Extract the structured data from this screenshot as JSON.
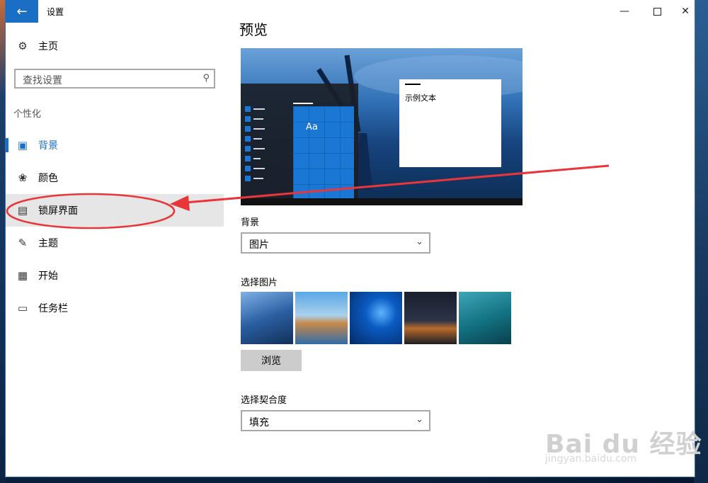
{
  "window": {
    "title": "设置",
    "back_icon": "arrow-left-icon",
    "accent": "#1a6fc4"
  },
  "sidebar": {
    "home_label": "主页",
    "search_placeholder": "查找设置",
    "section": "个性化",
    "items": [
      {
        "label": "背景",
        "icon": "picture-icon",
        "active": true
      },
      {
        "label": "颜色",
        "icon": "palette-icon",
        "active": false
      },
      {
        "label": "锁屏界面",
        "icon": "lock-screen-icon",
        "active": false,
        "highlighted": true
      },
      {
        "label": "主题",
        "icon": "theme-brush-icon",
        "active": false
      },
      {
        "label": "开始",
        "icon": "start-grid-icon",
        "active": false
      },
      {
        "label": "任务栏",
        "icon": "taskbar-icon",
        "active": false
      }
    ]
  },
  "main": {
    "heading": "预览",
    "preview_sample_text": "示例文本",
    "preview_tile_text": "Aa",
    "background_label": "背景",
    "background_value": "图片",
    "choose_picture_label": "选择图片",
    "browse_label": "浏览",
    "fit_label": "选择契合度",
    "fit_value": "填充"
  },
  "watermark": {
    "brand": "Bai du 经验",
    "url": "jingyan.baidu.com"
  }
}
